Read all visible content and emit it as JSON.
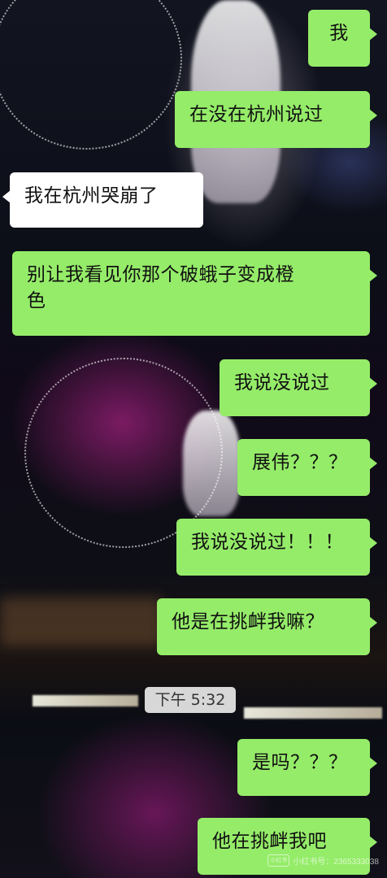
{
  "messages": [
    {
      "side": "out",
      "text": "我"
    },
    {
      "side": "out",
      "text": "在没在杭州说过"
    },
    {
      "side": "in",
      "text": "我在杭州哭崩了"
    },
    {
      "side": "out",
      "text": "别让我看见你那个破蛾子变成橙\n色"
    },
    {
      "side": "out",
      "text": "我说没说过"
    },
    {
      "side": "out",
      "text": "展伟？？？"
    },
    {
      "side": "out",
      "text": "我说没说过！！！"
    },
    {
      "side": "out",
      "text": "他是在挑衅我嘛？"
    },
    {
      "side": "out",
      "text": "是吗？？？"
    },
    {
      "side": "out",
      "text": "他在挑衅我吧"
    }
  ],
  "timestamp": "下午 5:32",
  "watermark": {
    "logo_text": "小红书",
    "text": "小红书号：2365333038"
  },
  "colors": {
    "outgoing_bubble": "#95ec69",
    "incoming_bubble": "#ffffff",
    "timestamp_bg": "#e8e8e8"
  }
}
